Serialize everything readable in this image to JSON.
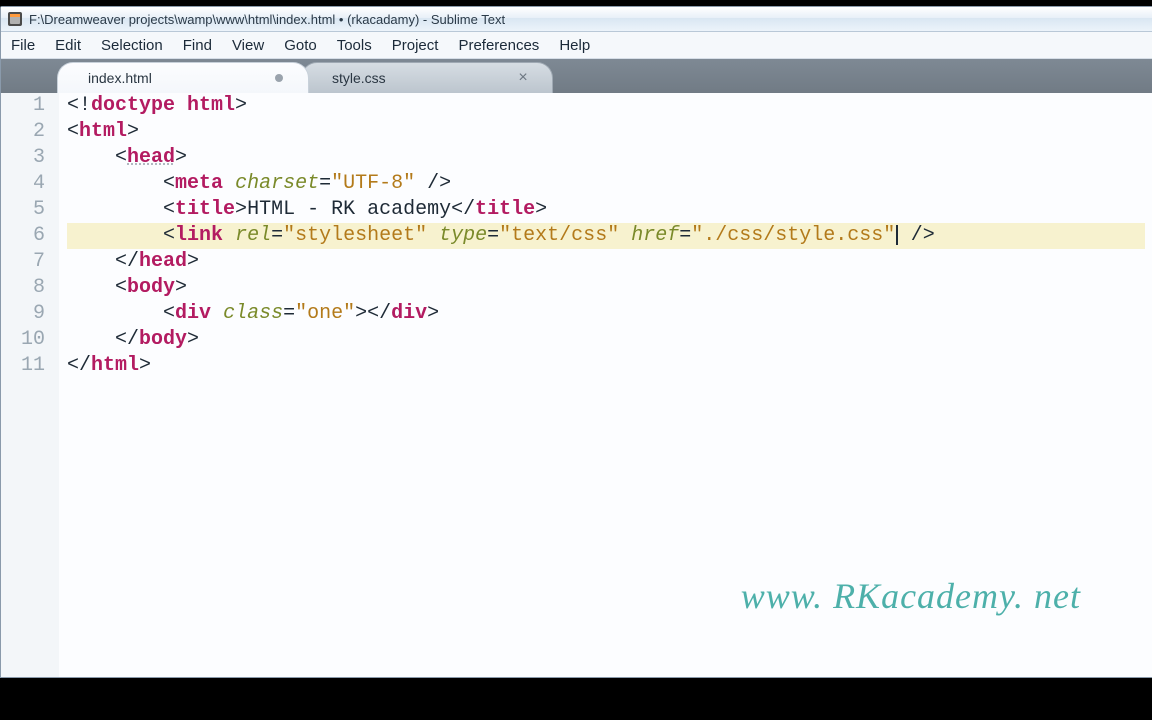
{
  "window": {
    "title": "F:\\Dreamweaver projects\\wamp\\www\\html\\index.html • (rkacadamy) - Sublime Text"
  },
  "menubar": [
    "File",
    "Edit",
    "Selection",
    "Find",
    "View",
    "Goto",
    "Tools",
    "Project",
    "Preferences",
    "Help"
  ],
  "tabs": [
    {
      "label": "index.html",
      "dirty": true
    },
    {
      "label": "style.css",
      "closeGlyph": "×"
    }
  ],
  "lineNumbers": [
    "1",
    "2",
    "3",
    "4",
    "5",
    "6",
    "7",
    "8",
    "9",
    "10",
    "11"
  ],
  "code": {
    "0": {
      "p0": "<!",
      "t0": "doctype html",
      "p1": ">"
    },
    "1": {
      "p0": "<",
      "t0": "html",
      "p1": ">"
    },
    "2": {
      "indent": "    ",
      "p0": "<",
      "t0": "head",
      "p1": ">"
    },
    "3": {
      "indent": "        ",
      "p0": "<",
      "t0": "meta",
      "a0": "charset",
      "eq": "=",
      "s0": "\"UTF-8\"",
      "p1": " />"
    },
    "4": {
      "indent": "        ",
      "p0": "<",
      "t0": "title",
      "p1": ">",
      "txt": "HTML - RK academy",
      "p2": "</",
      "t1": "title",
      "p3": ">"
    },
    "5": {
      "indent": "        ",
      "p0": "<",
      "t0": "link",
      "a0": "rel",
      "eq": "=",
      "s0": "\"stylesheet\"",
      "a1": "type",
      "s1": "\"text/css\"",
      "a2": "href",
      "s2": "\"./css/style.css\"",
      "p1": " />"
    },
    "6": {
      "indent": "    ",
      "p0": "</",
      "t0": "head",
      "p1": ">"
    },
    "7": {
      "indent": "    ",
      "p0": "<",
      "t0": "body",
      "p1": ">"
    },
    "8": {
      "indent": "        ",
      "p0": "<",
      "t0": "div",
      "a0": "class",
      "eq": "=",
      "s0": "\"one\"",
      "p1": ">",
      "p2": "</",
      "t1": "div",
      "p3": ">"
    },
    "9": {
      "indent": "    ",
      "p0": "</",
      "t0": "body",
      "p1": ">"
    },
    "10": {
      "p0": "</",
      "t0": "html",
      "p1": ">"
    }
  },
  "watermark": "www. RKacademy. net"
}
